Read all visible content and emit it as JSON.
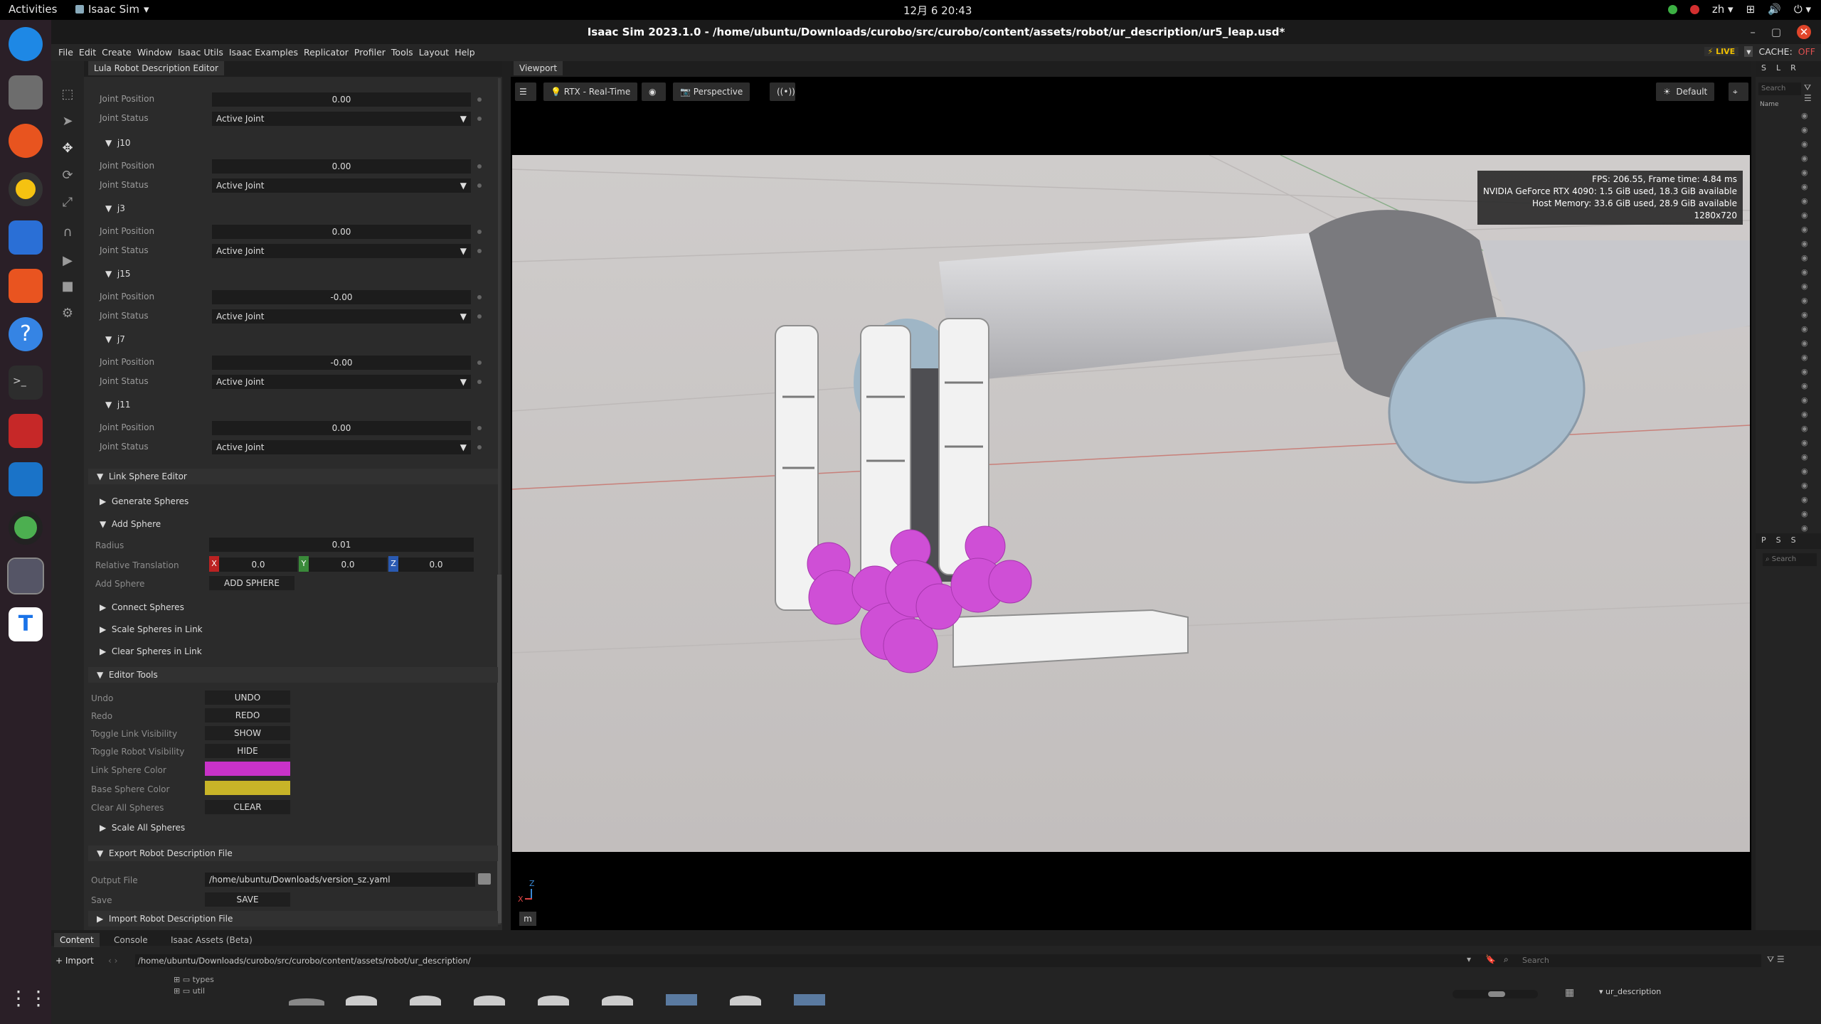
{
  "topbar": {
    "activities": "Activities",
    "app_name": "Isaac Sim",
    "clock": "12月 6  20:43",
    "lang": "zh"
  },
  "window": {
    "title": "Isaac Sim 2023.1.0 - /home/ubuntu/Downloads/curobo/src/curobo/content/assets/robot/ur_description/ur5_leap.usd*"
  },
  "menu": {
    "items": [
      "File",
      "Edit",
      "Create",
      "Window",
      "Isaac Utils",
      "Isaac Examples",
      "Replicator",
      "Profiler",
      "Tools",
      "Layout",
      "Help"
    ],
    "live": "LIVE",
    "cache": "CACHE:",
    "cache_state": "OFF"
  },
  "lula": {
    "tab": "Lula Robot Description Editor",
    "top_joint": {
      "position": "0.00",
      "status": "Active Joint"
    },
    "joints": [
      {
        "name": "j10",
        "position": "0.00",
        "status": "Active Joint"
      },
      {
        "name": "j3",
        "position": "0.00",
        "status": "Active Joint"
      },
      {
        "name": "j15",
        "position": "-0.00",
        "status": "Active Joint"
      },
      {
        "name": "j7",
        "position": "-0.00",
        "status": "Active Joint"
      },
      {
        "name": "j11",
        "position": "0.00",
        "status": "Active Joint"
      }
    ],
    "labels": {
      "joint_position": "Joint Position",
      "joint_status": "Joint Status"
    },
    "link_sphere_editor": "Link Sphere Editor",
    "generate_spheres": "Generate Spheres",
    "add_sphere_section": "Add Sphere",
    "radius_label": "Radius",
    "radius": "0.01",
    "rel_trans_label": "Relative Translation",
    "x": "0.0",
    "y": "0.0",
    "z": "0.0",
    "x_label": "X",
    "y_label": "Y",
    "z_label": "Z",
    "add_sphere_label": "Add Sphere",
    "add_sphere_btn": "ADD SPHERE",
    "connect_spheres": "Connect Spheres",
    "scale_spheres_link": "Scale Spheres in Link",
    "clear_spheres_link": "Clear Spheres in Link",
    "editor_tools": "Editor Tools",
    "undo_label": "Undo",
    "undo_btn": "UNDO",
    "redo_label": "Redo",
    "redo_btn": "REDO",
    "toggle_link_label": "Toggle Link Visibility",
    "toggle_link_btn": "SHOW",
    "toggle_robot_label": "Toggle Robot Visibility",
    "toggle_robot_btn": "HIDE",
    "link_color_label": "Link Sphere Color",
    "link_color": "#c832c8",
    "base_color_label": "Base Sphere Color",
    "base_color": "#c8b428",
    "clear_all_label": "Clear All Spheres",
    "clear_all_btn": "CLEAR",
    "scale_all": "Scale All Spheres",
    "export": "Export Robot Description File",
    "output_label": "Output File",
    "output_path": "/home/ubuntu/Downloads/version_sz.yaml",
    "save_label": "Save",
    "save_btn": "SAVE",
    "import": "Import Robot Description File"
  },
  "viewport": {
    "tab": "Viewport",
    "renderer": "RTX - Real-Time",
    "camera": "Perspective",
    "lighting": "Default",
    "hud": [
      "FPS: 206.55, Frame time: 4.84 ms",
      "NVIDIA GeForce RTX 4090: 1.5 GiB used, 18.3 GiB available",
      "Host Memory: 33.6 GiB used, 28.9 GiB available",
      "1280x720"
    ],
    "unit": "m",
    "axis_x": "X",
    "axis_z": "Z"
  },
  "stage": {
    "tabs": [
      "S",
      "L",
      "R"
    ],
    "search": "Search",
    "name_col": "Name",
    "props_tabs": [
      "P",
      "S",
      "S"
    ],
    "props_search": "Search"
  },
  "bottom": {
    "tabs": [
      "Content",
      "Console",
      "Isaac Assets (Beta)"
    ],
    "import": "Import",
    "path": "/home/ubuntu/Downloads/curobo/src/curobo/content/assets/robot/ur_description/",
    "search": "Search",
    "tree": [
      "types",
      "util"
    ],
    "folder": "ur_description"
  }
}
